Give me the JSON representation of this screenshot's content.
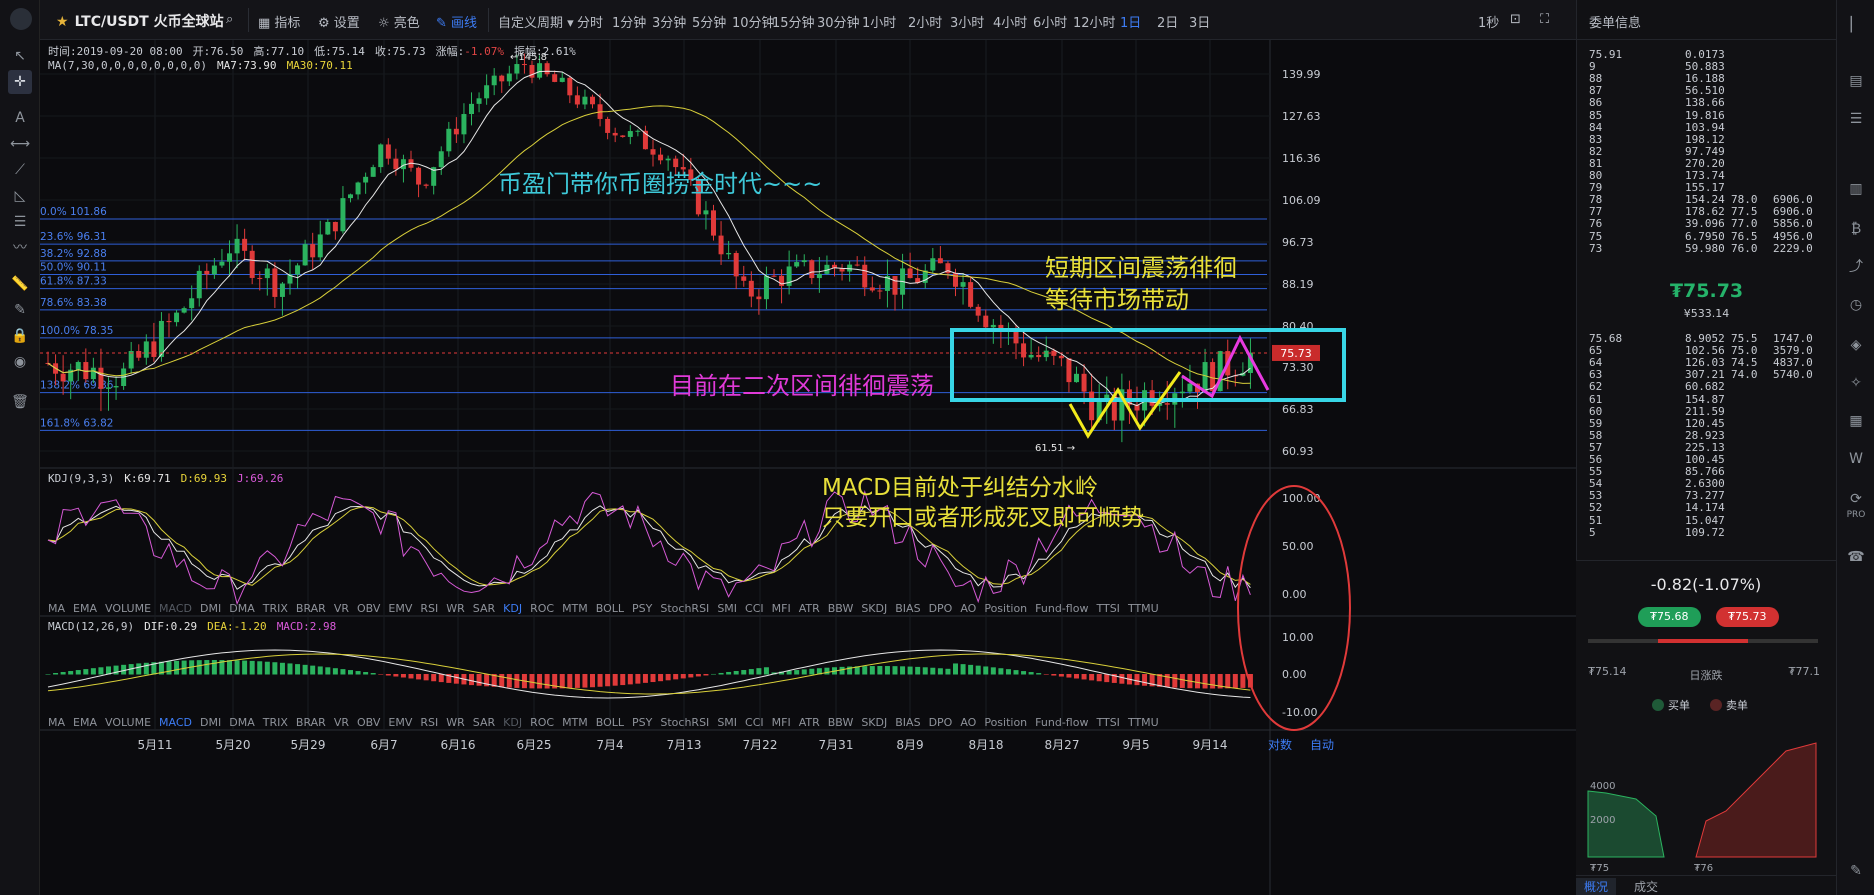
{
  "symbol": {
    "name": "LTC/USDT 火币全球站"
  },
  "toolbar": {
    "indicators": "指标",
    "settings": "设置",
    "theme": "亮色",
    "draw": "画线",
    "custom_period": "自定义周期",
    "periods": [
      "分时",
      "1分钟",
      "3分钟",
      "5分钟",
      "10分钟",
      "15分钟",
      "30分钟",
      "1小时",
      "2小时",
      "3小时",
      "4小时",
      "6小时",
      "12小时",
      "1日",
      "2日",
      "3日"
    ],
    "active_period": "1日",
    "refresh": "1秒"
  },
  "ohlc": {
    "time": "时间:2019-09-20 08:00",
    "open": "开:76.50",
    "high": "高:77.10",
    "low": "低:75.14",
    "close": "收:75.73",
    "change_label": "涨幅:",
    "change": "-1.07%",
    "amplitude": "振幅:2.61%"
  },
  "ma_legend": {
    "name": "MA(7,30,0,0,0,0,0,0,0,0)",
    "ma7": "MA7:73.90",
    "ma30": "MA30:70.11"
  },
  "kdj_legend": {
    "name": "KDJ(9,3,3)",
    "k": "K:69.71",
    "d": "D:69.93",
    "j": "J:69.26"
  },
  "macd_legend": {
    "name": "MACD(12,26,9)",
    "dif": "DIF:0.29",
    "dea": "DEA:-1.20",
    "macd": "MACD:2.98"
  },
  "indicator_tabs": [
    "MA",
    "EMA",
    "VOLUME",
    "MACD",
    "DMI",
    "DMA",
    "TRIX",
    "BRAR",
    "VR",
    "OBV",
    "EMV",
    "RSI",
    "WR",
    "SAR",
    "KDJ",
    "ROC",
    "MTM",
    "BOLL",
    "PSY",
    "StochRSI",
    "SMI",
    "CCI",
    "MFI",
    "ATR",
    "BBW",
    "SKDJ",
    "BIAS",
    "DPO",
    "AO",
    "Position",
    "Fund-flow",
    "TTSI",
    "TTMU"
  ],
  "fib_levels": [
    {
      "label": "0.0% 101.86",
      "value": 101.86
    },
    {
      "label": "23.6% 96.31",
      "value": 96.31
    },
    {
      "label": "38.2% 92.88",
      "value": 92.88
    },
    {
      "label": "50.0% 90.11",
      "value": 90.11
    },
    {
      "label": "61.8% 87.33",
      "value": 87.33
    },
    {
      "label": "78.6% 83.38",
      "value": 83.38
    },
    {
      "label": "100.0% 78.35",
      "value": 78.35
    },
    {
      "label": "138.2% 69.36",
      "value": 69.36
    },
    {
      "label": "161.8% 63.82",
      "value": 63.82
    }
  ],
  "price_axis": [
    "139.99",
    "127.63",
    "116.36",
    "106.09",
    "96.73",
    "88.19",
    "80.40",
    "73.30",
    "66.83",
    "60.93"
  ],
  "current_price_tag": "75.73",
  "high_marker": "←145.8",
  "low_marker": "61.51 →",
  "kdj_axis": [
    "100.00",
    "50.00",
    "0.00"
  ],
  "macd_axis": [
    "10.00",
    "0.00",
    "-10.00"
  ],
  "date_axis": [
    "5月11",
    "5月20",
    "5月29",
    "6月7",
    "6月16",
    "6月25",
    "7月4",
    "7月13",
    "7月22",
    "7月31",
    "8月9",
    "8月18",
    "8月27",
    "9月5",
    "9月14"
  ],
  "axis_buttons": {
    "log": "对数",
    "auto": "自动"
  },
  "annotations": {
    "slogan": "币盈门带你币圈捞金时代~~~",
    "short_term_1": "短期区间震荡徘徊",
    "short_term_2": "等待市场带动",
    "current": "目前在二次区间徘徊震荡",
    "macd_1": "MACD目前处于纠结分水岭",
    "macd_2": "只要开口或者形成死叉即可顺势"
  },
  "colors": {
    "up": "#2bb35f",
    "down": "#e03a3a",
    "accent": "#3d7cf4",
    "annot_cyan": "#3ec8d8",
    "annot_yellow": "#e8e03a",
    "annot_magenta": "#e03ad8",
    "box": "#38d6e6",
    "ellipse": "#e03a3a"
  },
  "order_book": {
    "title": "委单信息",
    "asks": [
      {
        "p": "75.91",
        "q": "0.0173"
      },
      {
        "p": "9",
        "q": "50.883"
      },
      {
        "p": "88",
        "q": "16.188"
      },
      {
        "p": "87",
        "q": "56.510"
      },
      {
        "p": "86",
        "q": "138.66"
      },
      {
        "p": "85",
        "q": "19.816"
      },
      {
        "p": "84",
        "q": "103.94"
      },
      {
        "p": "83",
        "q": "198.12"
      },
      {
        "p": "82",
        "q": "97.749"
      },
      {
        "p": "81",
        "q": "270.20"
      },
      {
        "p": "80",
        "q": "173.74"
      },
      {
        "p": "79",
        "q": "155.17"
      },
      {
        "p": "78",
        "q": "154.24",
        "bp": "78.0",
        "bq": "6906.0"
      },
      {
        "p": "77",
        "q": "178.62",
        "bp": "77.5",
        "bq": "6906.0"
      },
      {
        "p": "76",
        "q": "39.096",
        "bp": "77.0",
        "bq": "5856.0"
      },
      {
        "p": "75",
        "q": "6.7950",
        "bp": "76.5",
        "bq": "4956.0"
      },
      {
        "p": "73",
        "q": "59.980",
        "bp": "76.0",
        "bq": "2229.0"
      }
    ],
    "last_price": "₮75.73",
    "last_cny": "¥533.14",
    "bids": [
      {
        "p": "75.68",
        "q": "8.9052",
        "bp": "75.5",
        "bq": "1747.0"
      },
      {
        "p": "65",
        "q": "102.56",
        "bp": "75.0",
        "bq": "3579.0"
      },
      {
        "p": "64",
        "q": "126.03",
        "bp": "74.5",
        "bq": "4837.0"
      },
      {
        "p": "63",
        "q": "307.21",
        "bp": "74.0",
        "bq": "5740.0"
      },
      {
        "p": "62",
        "q": "60.682"
      },
      {
        "p": "61",
        "q": "154.87"
      },
      {
        "p": "60",
        "q": "211.59"
      },
      {
        "p": "59",
        "q": "120.45"
      },
      {
        "p": "58",
        "q": "28.923"
      },
      {
        "p": "57",
        "q": "225.13"
      },
      {
        "p": "56",
        "q": "100.45"
      },
      {
        "p": "55",
        "q": "85.766"
      },
      {
        "p": "54",
        "q": "2.6300"
      },
      {
        "p": "53",
        "q": "73.277"
      },
      {
        "p": "52",
        "q": "14.174"
      },
      {
        "p": "51",
        "q": "15.047"
      },
      {
        "p": "5",
        "q": "109.72"
      }
    ]
  },
  "summary": {
    "change": "-0.82(-1.07%)",
    "buy_pill": "₮75.68",
    "sell_pill": "₮75.73",
    "low": "₮75.14",
    "high": "₮77.1",
    "range_label": "日涨跌",
    "legend_buy": "买单",
    "legend_sell": "卖单",
    "depth_y": [
      "4000",
      "2000"
    ],
    "depth_x": [
      "₮75",
      "₮76"
    ],
    "tab_overview": "概况",
    "tab_trades": "成交"
  },
  "chart_data": {
    "type": "candlestick",
    "interval": "1d",
    "ylim": [
      59,
      148
    ],
    "last_close": 75.73
  }
}
